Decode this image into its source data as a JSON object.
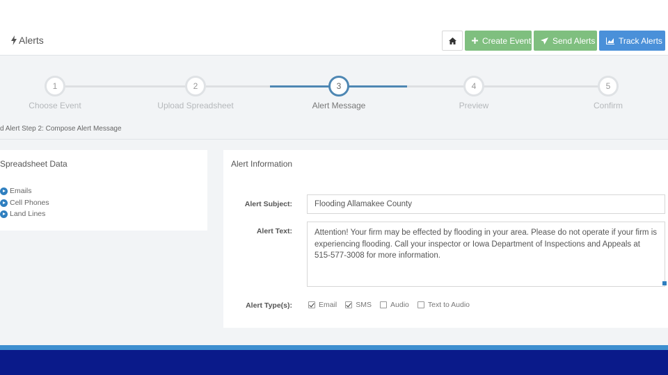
{
  "header": {
    "title": "Alerts",
    "icon": "bolt-icon",
    "buttons": {
      "home_icon": "home-icon",
      "create_event": "Create Event",
      "send_alerts": "Send Alerts",
      "track_alerts": "Track Alerts"
    }
  },
  "wizard": {
    "current_step": 3,
    "steps": [
      {
        "number": "1",
        "label": "Choose Event"
      },
      {
        "number": "2",
        "label": "Upload Spreadsheet"
      },
      {
        "number": "3",
        "label": "Alert Message"
      },
      {
        "number": "4",
        "label": "Preview"
      },
      {
        "number": "5",
        "label": "Confirm"
      }
    ]
  },
  "breadcrumb": "d Alert Step 2: Compose Alert Message",
  "spreadsheet_panel": {
    "title": "Spreadsheet Data",
    "items": [
      "Emails",
      "Cell Phones",
      "Land Lines"
    ]
  },
  "alert_panel": {
    "title": "Alert Information",
    "subject_label": "Alert Subject:",
    "subject_value": "Flooding Allamakee County",
    "text_label": "Alert Text:",
    "text_value": "Attention! Your firm may be effected by flooding in your area. Please do not operate if your firm is experiencing flooding. Call your inspector or Iowa Department of Inspections and Appeals at 515-577-3008 for more information.",
    "types_label": "Alert Type(s):",
    "types": [
      {
        "label": "Email",
        "checked": true
      },
      {
        "label": "SMS",
        "checked": true
      },
      {
        "label": "Audio",
        "checked": false
      },
      {
        "label": "Text to Audio",
        "checked": false
      }
    ]
  },
  "colors": {
    "accent": "#4e87b3",
    "green_button": "#7fbf7f",
    "blue_button": "#4a90d9",
    "footer_light": "#3e8fd0",
    "footer_dark": "#0a1a8a"
  }
}
